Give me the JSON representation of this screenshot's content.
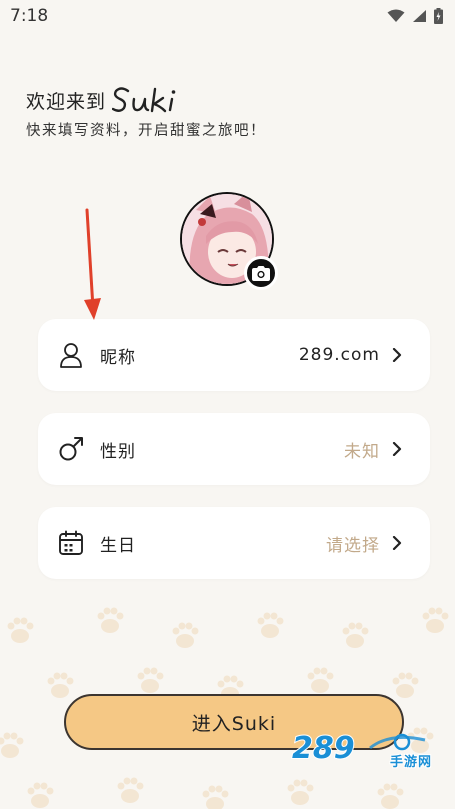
{
  "status_bar": {
    "time": "7:18"
  },
  "header": {
    "welcome": "欢迎来到",
    "brand": "Suki",
    "subtitle": "快来填写资料，开启甜蜜之旅吧！"
  },
  "profile_rows": [
    {
      "label": "昵称",
      "value": "289.com",
      "icon": "person-icon"
    },
    {
      "label": "性别",
      "value": "未知",
      "icon": "male-gender-icon"
    },
    {
      "label": "生日",
      "value": "请选择",
      "icon": "calendar-icon"
    }
  ],
  "enter_button": {
    "label": "进入Suki"
  },
  "watermark": {
    "text": "289",
    "subtext": "手游网"
  },
  "colors": {
    "background": "#f8f6f2",
    "button": "#f5c885",
    "muted_value": "#c2a98a",
    "arrow": "#e0402a"
  }
}
